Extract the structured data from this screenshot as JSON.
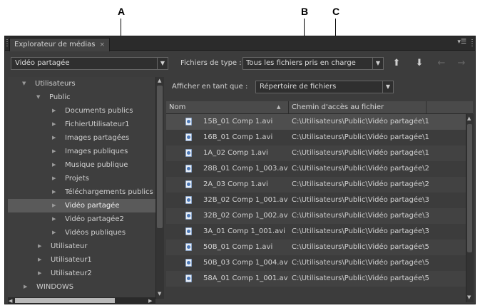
{
  "callouts": {
    "a": "A",
    "b": "B",
    "c": "C"
  },
  "panel": {
    "tab_title": "Explorateur de médias",
    "close_glyph": "×"
  },
  "toolbar": {
    "source_value": "Vidéo partagée",
    "type_label": "Fichiers de type :",
    "type_value": "Tous les fichiers pris en charge"
  },
  "icons": {
    "dropdown": "▼",
    "up": "⬆",
    "down": "⬇",
    "back": "←",
    "forward": "→"
  },
  "view": {
    "label": "Afficher en tant que :",
    "value": "Répertoire de fichiers"
  },
  "tree": {
    "items": [
      {
        "label": "Utilisateurs",
        "expanded": true
      },
      {
        "label": "Public",
        "expanded": true
      },
      {
        "label": "Documents publics"
      },
      {
        "label": "FichierUtilisateur1"
      },
      {
        "label": "Images partagées"
      },
      {
        "label": "Images publiques"
      },
      {
        "label": "Musique publique"
      },
      {
        "label": "Projets"
      },
      {
        "label": "Téléchargements publics"
      },
      {
        "label": "Vidéo partagée",
        "selected": true
      },
      {
        "label": "Vidéo partagée2"
      },
      {
        "label": "Vidéos publiques"
      },
      {
        "label": "Utilisateur"
      },
      {
        "label": "Utilisateur1"
      },
      {
        "label": "Utilisateur2"
      },
      {
        "label": "WINDOWS"
      }
    ]
  },
  "table": {
    "columns": {
      "name": "Nom",
      "path": "Chemin d'accès au fichier"
    },
    "rows": [
      {
        "name": "15B_01 Comp 1.avi",
        "path": "C:\\Utilisateurs\\Public\\Vidéo partagée\\1"
      },
      {
        "name": "16B_01 Comp 1.avi",
        "path": "C:\\Utilisateurs\\Public\\Vidéo partagée\\1"
      },
      {
        "name": "1A_02 Comp 1.avi",
        "path": "C:\\Utilisateurs\\Public\\Vidéo partagée\\1"
      },
      {
        "name": "28B_01 Comp 1_003.av",
        "path": "C:\\Utilisateurs\\Public\\Vidéo partagée\\2"
      },
      {
        "name": "2A_03 Comp 1.avi",
        "path": "C:\\Utilisateurs\\Public\\Vidéo partagée\\2"
      },
      {
        "name": "32B_02 Comp 1_001.av",
        "path": "C:\\Utilisateurs\\Public\\Vidéo partagée\\3"
      },
      {
        "name": "32B_02 Comp 1_002.av",
        "path": "C:\\Utilisateurs\\Public\\Vidéo partagée\\3"
      },
      {
        "name": "3A_01 Comp 1_001.avi",
        "path": "C:\\Utilisateurs\\Public\\Vidéo partagée\\3"
      },
      {
        "name": "50B_01 Comp 1.avi",
        "path": "C:\\Utilisateurs\\Public\\Vidéo partagée\\5"
      },
      {
        "name": "50B_03 Comp 1_004.av",
        "path": "C:\\Utilisateurs\\Public\\Vidéo partagée\\5"
      },
      {
        "name": "58A_01 Comp 1_001.av",
        "path": "C:\\Utilisateurs\\Public\\Vidéo partagée\\5"
      }
    ]
  }
}
